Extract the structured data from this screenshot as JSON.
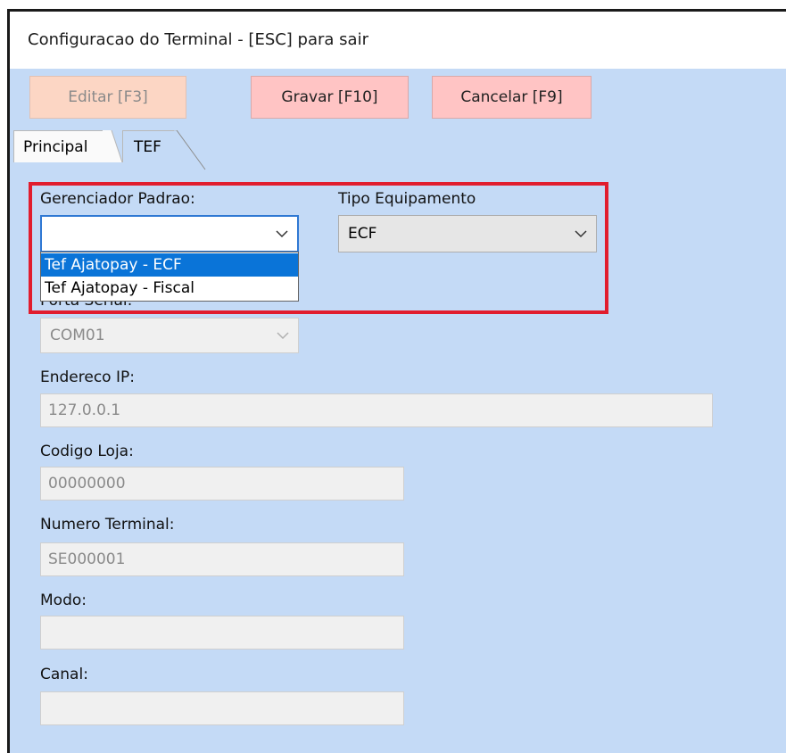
{
  "window": {
    "title": "Configuracao do Terminal - [ESC] para sair"
  },
  "toolbar": {
    "edit_label": "Editar [F3]",
    "save_label": "Gravar [F10]",
    "cancel_label": "Cancelar [F9]"
  },
  "tabs": [
    {
      "label": "Principal"
    },
    {
      "label": "TEF"
    }
  ],
  "form": {
    "gerenciador": {
      "label": "Gerenciador Padrao:",
      "value": "",
      "options": [
        "Tef Ajatopay - ECF",
        "Tef Ajatopay - Fiscal"
      ],
      "highlighted_option": "Tef Ajatopay - ECF"
    },
    "tipo_equipamento": {
      "label": "Tipo Equipamento",
      "value": "ECF"
    },
    "porta_serial": {
      "label": "Porta Serial:",
      "value": "COM01"
    },
    "endereco_ip": {
      "label": "Endereco IP:",
      "value": "127.0.0.1"
    },
    "codigo_loja": {
      "label": "Codigo Loja:",
      "value": "00000000"
    },
    "numero_terminal": {
      "label": "Numero Terminal:",
      "value": "SE000001"
    },
    "modo": {
      "label": "Modo:",
      "value": ""
    },
    "canal": {
      "label": "Canal:",
      "value": ""
    }
  },
  "colors": {
    "panel_bg": "#c4daf6",
    "button_pink": "#ffc4c4",
    "highlight_red": "#e11d2e",
    "selection_blue": "#0a74d8"
  },
  "icons": {
    "dropdown_arrow": "chevron-down-icon"
  }
}
